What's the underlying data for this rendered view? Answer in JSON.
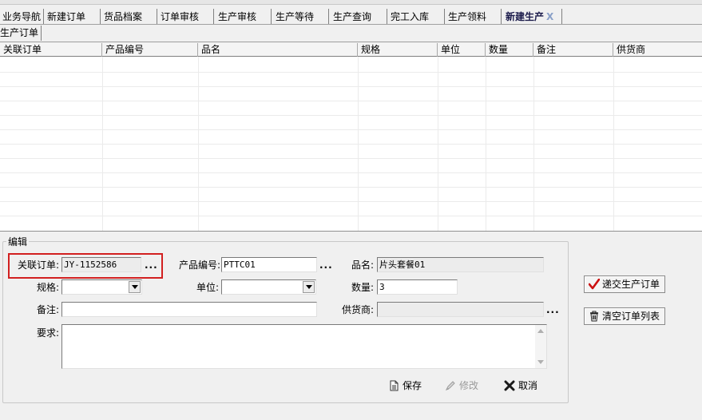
{
  "tabs": [
    {
      "label": "业务导航",
      "active": false
    },
    {
      "label": "新建订单",
      "active": false
    },
    {
      "label": "货品档案",
      "active": false
    },
    {
      "label": "订单审核",
      "active": false
    },
    {
      "label": "生产审核",
      "active": false
    },
    {
      "label": "生产等待",
      "active": false
    },
    {
      "label": "生产查询",
      "active": false
    },
    {
      "label": "完工入库",
      "active": false
    },
    {
      "label": "生产领料",
      "active": false
    },
    {
      "label": "新建生产",
      "active": true
    }
  ],
  "close_tab_glyph": "X",
  "subtab": {
    "label": "生产订单"
  },
  "grid": {
    "columns": [
      "关联订单",
      "产品编号",
      "品名",
      "规格",
      "单位",
      "数量",
      "备注",
      "供货商"
    ],
    "rows": []
  },
  "edit": {
    "group_title": "编辑",
    "related_order": {
      "label": "关联订单:",
      "value": "JY-1152586"
    },
    "product_code": {
      "label": "产品编号:",
      "value": "PTTC01"
    },
    "product_name": {
      "label": "品名:",
      "value": "片头套餐01"
    },
    "spec": {
      "label": "规格:",
      "value": ""
    },
    "unit": {
      "label": "单位:",
      "value": ""
    },
    "quantity": {
      "label": "数量:",
      "value": "3"
    },
    "remark": {
      "label": "备注:",
      "value": ""
    },
    "supplier": {
      "label": "供货商:",
      "value": ""
    },
    "requirement": {
      "label": "要求:",
      "value": ""
    },
    "ellipsis": "..."
  },
  "actions": {
    "save": "保存",
    "modify": "修改",
    "cancel": "取消",
    "submit": "递交生产订单",
    "clear": "清空订单列表"
  },
  "colors": {
    "highlight": "#d22020",
    "submit_check": "#cc1010",
    "cancel_x": "#1a1a1a"
  }
}
